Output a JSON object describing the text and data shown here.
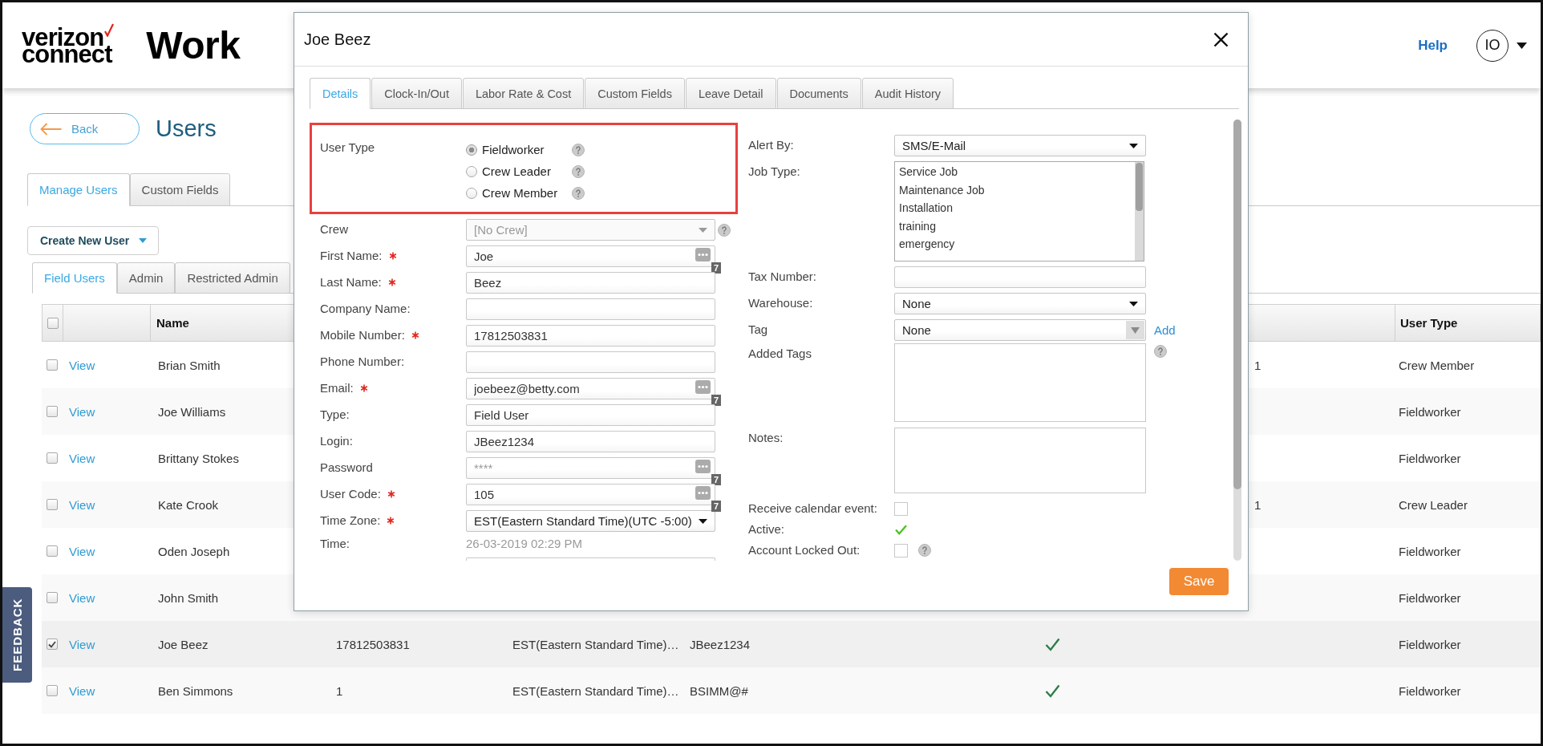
{
  "header": {
    "logo": {
      "line_1": "verizon",
      "line_2": "connect"
    },
    "product": "Work",
    "help_link": "Help",
    "avatar_initials": "IO"
  },
  "page": {
    "back_button": "Back",
    "title": "Users",
    "tabs": [
      {
        "label": "Manage Users",
        "selected": true
      },
      {
        "label": "Custom Fields",
        "selected": false
      }
    ],
    "create_button": "Create New User",
    "user_tabs": [
      {
        "label": "Field Users",
        "selected": true
      },
      {
        "label": "Admin",
        "selected": false
      },
      {
        "label": "Restricted Admin",
        "selected": false
      }
    ]
  },
  "table": {
    "header": {
      "select_all_checked": false,
      "name": "Name",
      "user_type": "User Type"
    },
    "rows": [
      {
        "checked": false,
        "view": "View",
        "name": "Brian Smith",
        "column_8": "1",
        "user_type": "Crew Member"
      },
      {
        "checked": false,
        "view": "View",
        "name": "Joe Williams",
        "user_type": "Fieldworker"
      },
      {
        "checked": false,
        "view": "View",
        "name": "Brittany Stokes",
        "user_type": "Fieldworker"
      },
      {
        "checked": false,
        "view": "View",
        "name": "Kate Crook",
        "column_8": "1",
        "user_type": "Crew Leader"
      },
      {
        "checked": false,
        "view": "View",
        "name": "Oden Joseph",
        "user_type": "Fieldworker"
      },
      {
        "checked": false,
        "view": "View",
        "name": "John Smith",
        "user_type": "Fieldworker"
      },
      {
        "checked": true,
        "view": "View",
        "name": "Joe Beez",
        "column_4": "17812503831",
        "column_5": "EST(Eastern Standard Time)…",
        "column_6": "JBeez1234",
        "column_7_checked": true,
        "user_type": "Fieldworker"
      },
      {
        "checked": false,
        "view": "View",
        "name": "Ben Simmons",
        "column_4": "1",
        "column_5": "EST(Eastern Standard Time)…",
        "column_6": "BSIMM@#",
        "column_7_checked": true,
        "user_type": "Fieldworker"
      }
    ]
  },
  "feedback_tab": "FEEDBACK",
  "dialog": {
    "title": "Joe Beez",
    "tabs": [
      {
        "label": "Details",
        "selected": true
      },
      {
        "label": "Clock-In/Out",
        "selected": false
      },
      {
        "label": "Labor Rate & Cost",
        "selected": false
      },
      {
        "label": "Custom Fields",
        "selected": false
      },
      {
        "label": "Leave Detail",
        "selected": false
      },
      {
        "label": "Documents",
        "selected": false
      },
      {
        "label": "Audit History",
        "selected": false
      }
    ],
    "user_type": {
      "label": "User Type",
      "highlighted": true,
      "options": [
        {
          "label": "Fieldworker",
          "selected": true,
          "help": true
        },
        {
          "label": "Crew Leader",
          "selected": false,
          "help": true
        },
        {
          "label": "Crew Member",
          "selected": false,
          "help": true
        }
      ]
    },
    "left_fields": [
      {
        "kind": "select",
        "label": "Crew",
        "required": false,
        "value": "[No Crew]",
        "disabled": true,
        "help": true
      },
      {
        "kind": "text",
        "label": "First Name:",
        "required": true,
        "value": "Joe",
        "more_button": true,
        "badge": "7",
        "help": false
      },
      {
        "kind": "text",
        "label": "Last Name:",
        "required": true,
        "value": "Beez",
        "help": false
      },
      {
        "kind": "text",
        "label": "Company Name:",
        "required": false,
        "help": false
      },
      {
        "kind": "text",
        "label": "Mobile Number:",
        "required": true,
        "value": "17812503831",
        "help": false
      },
      {
        "kind": "text",
        "label": "Phone Number:",
        "required": false,
        "help": false
      },
      {
        "kind": "text",
        "label": "Email:",
        "required": true,
        "value": "joebeez@betty.com",
        "more_button": true,
        "badge": "7",
        "help": false
      },
      {
        "kind": "text",
        "label": "Type:",
        "required": false,
        "value": "Field User",
        "help": false
      },
      {
        "kind": "text",
        "label": "Login:",
        "required": false,
        "value": "JBeez1234",
        "help": false
      },
      {
        "kind": "text",
        "label": "Password",
        "required": false,
        "placeholder": "****",
        "more_button": true,
        "badge": "7",
        "help": false
      },
      {
        "kind": "text",
        "label": "User Code:",
        "required": true,
        "value": "105",
        "more_button": true,
        "badge": "7",
        "help": false
      },
      {
        "kind": "select",
        "label": "Time Zone:",
        "required": true,
        "value": "EST(Eastern Standard Time)(UTC -5:00)",
        "disabled": false,
        "help": false
      },
      {
        "kind": "static",
        "label": "Time:",
        "value": "26-03-2019 02:29 PM"
      },
      {
        "kind": "cut_off"
      }
    ],
    "right_fields": [
      {
        "kind": "select",
        "label": "Alert By:",
        "value": "SMS/E-Mail",
        "disabled": false,
        "help": false
      },
      {
        "kind": "listbox",
        "label": "Job Type:",
        "items": [
          "Service Job",
          "Maintenance Job",
          "Installation",
          "training",
          "emergency"
        ],
        "help": false
      },
      {
        "kind": "text",
        "label": "Tax Number:",
        "help": false
      },
      {
        "kind": "select",
        "label": "Warehouse:",
        "value": "None",
        "disabled": false,
        "help": false
      },
      {
        "kind": "combo",
        "label": "Tag",
        "value": "None",
        "link": "Add",
        "help": false
      },
      {
        "kind": "tag_list",
        "label": "Added Tags",
        "help": true
      },
      {
        "kind": "textarea",
        "label": "Notes:",
        "help": false
      },
      {
        "kind": "checkbox",
        "label": "Receive calendar event:",
        "checked": false,
        "help": false
      },
      {
        "kind": "checkbox",
        "label": "Active:",
        "checked": true,
        "help": false
      },
      {
        "kind": "checkbox",
        "label": "Account Locked Out:",
        "checked": false,
        "help": true
      }
    ],
    "save_button": "Save"
  }
}
